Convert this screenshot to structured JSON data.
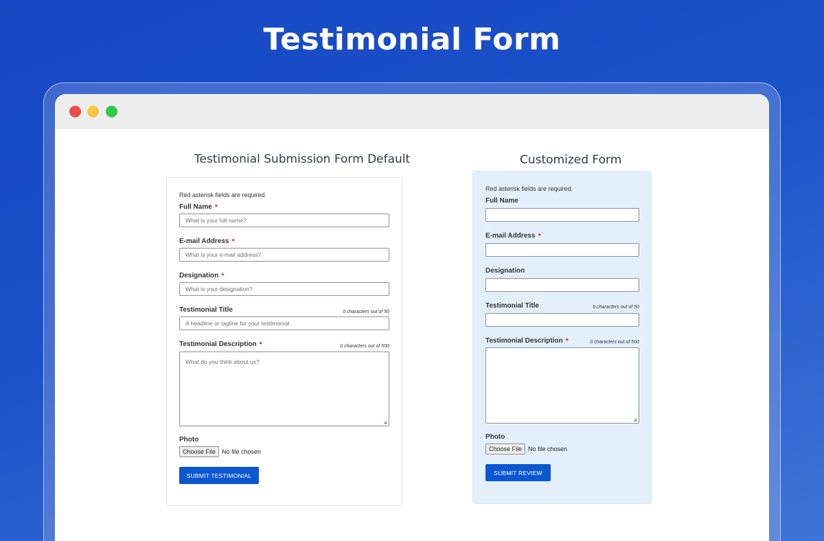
{
  "hero": {
    "title": "Testimonial Form"
  },
  "default_form": {
    "heading": "Testimonial Submission Form Default",
    "required_note": "Red asterisk fields are required.",
    "full_name": {
      "label": "Full Name",
      "placeholder": "What is your full name?"
    },
    "email": {
      "label": "E-mail Address",
      "placeholder": "What is your e-mail address?"
    },
    "designation": {
      "label": "Designation",
      "placeholder": "What is your designation?"
    },
    "title": {
      "label": "Testimonial Title",
      "counter": "0 characters out of 50",
      "placeholder": "A headline or tagline for your testimonial."
    },
    "description": {
      "label": "Testimonial Description",
      "counter": "0 characters out of 500",
      "placeholder": "What do you think about us?"
    },
    "photo": {
      "label": "Photo",
      "button": "Choose File",
      "status": "No file chosen"
    },
    "submit_label": "SUBMIT TESTIMONIAL",
    "required_marker": "*"
  },
  "custom_form": {
    "heading": "Customized Form",
    "required_note": "Red asterisk fields are required.",
    "full_name": {
      "label": "Full Name"
    },
    "email": {
      "label": "E-mail Address"
    },
    "designation": {
      "label": "Designation"
    },
    "title": {
      "label": "Testimonial Title",
      "counter": "0 characters out of 50"
    },
    "description": {
      "label": "Testimonial Description",
      "counter": "0 characters out of 500"
    },
    "photo": {
      "label": "Photo",
      "button": "Choose File",
      "status": "No file chosen"
    },
    "submit_label": "SUBMIT REVIEW",
    "required_marker": "*"
  },
  "colors": {
    "background": "#1c52c9",
    "submit_button": "#0b57d0",
    "required_star": "#d63638",
    "custom_card": "#e3f0fb"
  }
}
